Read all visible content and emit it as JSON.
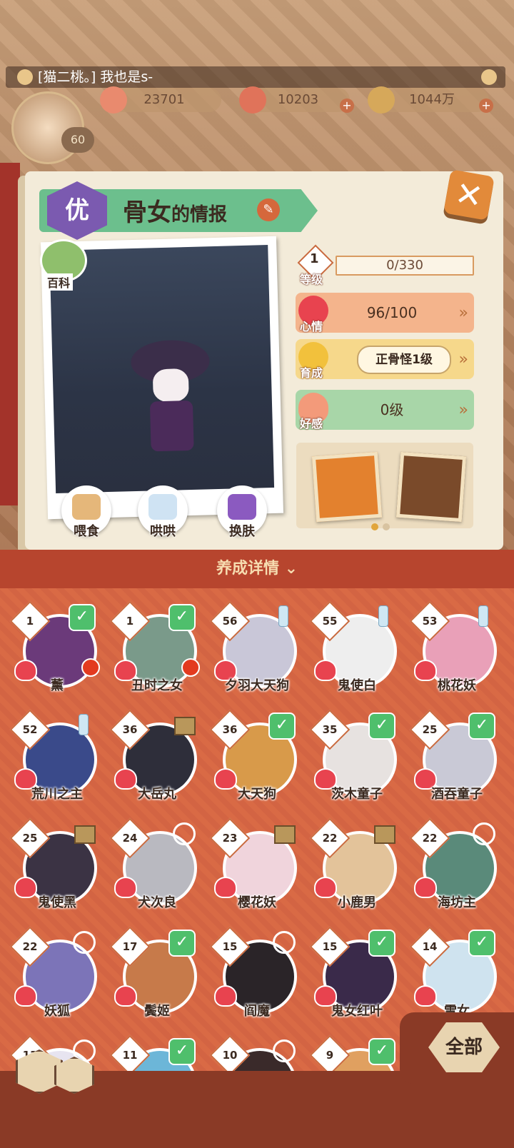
{
  "chat": {
    "message": "[猫二桃。] 我也是s-"
  },
  "player": {
    "level": "60"
  },
  "resources": [
    {
      "icon": "jade-icon",
      "value": "23701"
    },
    {
      "icon": "stamina-icon",
      "value": "10203"
    },
    {
      "icon": "coin-icon",
      "value": "1044万"
    }
  ],
  "info": {
    "grade": "优",
    "name": "骨女",
    "suffix": "的情报",
    "encyclopedia_label": "百科"
  },
  "actions": {
    "feed": "喂食",
    "coax": "哄哄",
    "skin": "换肤"
  },
  "stats": {
    "level_num": "1",
    "level_label": "等级",
    "level_progress": "0/330",
    "mood_label": "心情",
    "mood_value": "96/100",
    "growth_label": "育成",
    "growth_value": "正骨怪1级",
    "favor_label": "好感",
    "favor_value": "0级"
  },
  "detail_header": "养成详情",
  "shikigami": [
    {
      "level": "1",
      "name": "薰",
      "badge": "check",
      "reddot": true,
      "color": "#6b3a7a"
    },
    {
      "level": "1",
      "name": "丑时之女",
      "badge": "check",
      "reddot": true,
      "color": "#7a9a8a"
    },
    {
      "level": "56",
      "name": "夕羽大天狗",
      "badge": "bottle",
      "reddot": false,
      "color": "#c9c7d8"
    },
    {
      "level": "55",
      "name": "鬼使白",
      "badge": "bottle",
      "reddot": false,
      "color": "#eeeeee"
    },
    {
      "level": "53",
      "name": "桃花妖",
      "badge": "bottle",
      "reddot": false,
      "color": "#e9a0b8"
    },
    {
      "level": "52",
      "name": "荒川之主",
      "badge": "bottle",
      "reddot": false,
      "color": "#3a4a8a"
    },
    {
      "level": "36",
      "name": "大岳丸",
      "badge": "scroll",
      "reddot": false,
      "color": "#2e2e3a"
    },
    {
      "level": "36",
      "name": "大天狗",
      "badge": "check",
      "reddot": false,
      "color": "#d89a4a"
    },
    {
      "level": "35",
      "name": "茨木童子",
      "badge": "check",
      "reddot": false,
      "color": "#e7e2e0"
    },
    {
      "level": "25",
      "name": "酒吞童子",
      "badge": "check",
      "reddot": false,
      "color": "#c9c9d6"
    },
    {
      "level": "25",
      "name": "鬼使黑",
      "badge": "scroll",
      "reddot": false,
      "color": "#3b3344"
    },
    {
      "level": "24",
      "name": "犬次良",
      "badge": "circle",
      "reddot": false,
      "color": "#b9b9c0"
    },
    {
      "level": "23",
      "name": "樱花妖",
      "badge": "scroll",
      "reddot": false,
      "color": "#f0d4dc"
    },
    {
      "level": "22",
      "name": "小鹿男",
      "badge": "scroll",
      "reddot": false,
      "color": "#e3c39a"
    },
    {
      "level": "22",
      "name": "海坊主",
      "badge": "circle",
      "reddot": false,
      "color": "#5a8a7a"
    },
    {
      "level": "22",
      "name": "妖狐",
      "badge": "circle",
      "reddot": false,
      "color": "#7c74b8"
    },
    {
      "level": "17",
      "name": "鬓姬",
      "badge": "check",
      "reddot": false,
      "color": "#c77a4a"
    },
    {
      "level": "15",
      "name": "阎魔",
      "badge": "circle",
      "reddot": false,
      "color": "#2a2428"
    },
    {
      "level": "15",
      "name": "鬼女红叶",
      "badge": "check",
      "reddot": false,
      "color": "#3a2a4a"
    },
    {
      "level": "14",
      "name": "雪女",
      "badge": "check",
      "reddot": false,
      "color": "#cfe3ef"
    },
    {
      "level": "13",
      "name": "",
      "badge": "circle",
      "reddot": false,
      "color": "#e7e4f0"
    },
    {
      "level": "11",
      "name": "",
      "badge": "check",
      "reddot": false,
      "color": "#6cb6d8"
    },
    {
      "level": "10",
      "name": "",
      "badge": "circle",
      "reddot": false,
      "color": "#3a2a2a"
    },
    {
      "level": "9",
      "name": "",
      "badge": "check",
      "reddot": false,
      "color": "#e0a060"
    }
  ],
  "all_button": "全部"
}
